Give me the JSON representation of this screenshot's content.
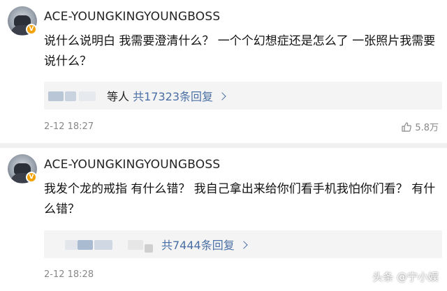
{
  "comments": [
    {
      "username": "ACE-YOUNGKINGYOUNGBOSS",
      "badge": "V",
      "text": "说什么说明白 我需要澄清什么？ 一个个幻想症还是怎么了 一张照片我需要说什么？",
      "reply": {
        "prefix": "等人",
        "link": "共17323条回复"
      },
      "date": "2-12 18:27",
      "likes": "5.8万"
    },
    {
      "username": "ACE-YOUNGKINGYOUNGBOSS",
      "badge": "V",
      "text": "我发个龙的戒指 有什么错？ 我自己拿出来给你们看手机我怕你们看？ 有什么错？",
      "reply": {
        "prefix": "",
        "link": "共7444条回复"
      },
      "date": "2-12 18:28"
    }
  ],
  "watermark": "头条 @宁小娱",
  "colors": {
    "link": "#4a6fa5",
    "badge": "#f2a20a",
    "reply_bg": "#f4f4f4",
    "meta": "#888888"
  }
}
